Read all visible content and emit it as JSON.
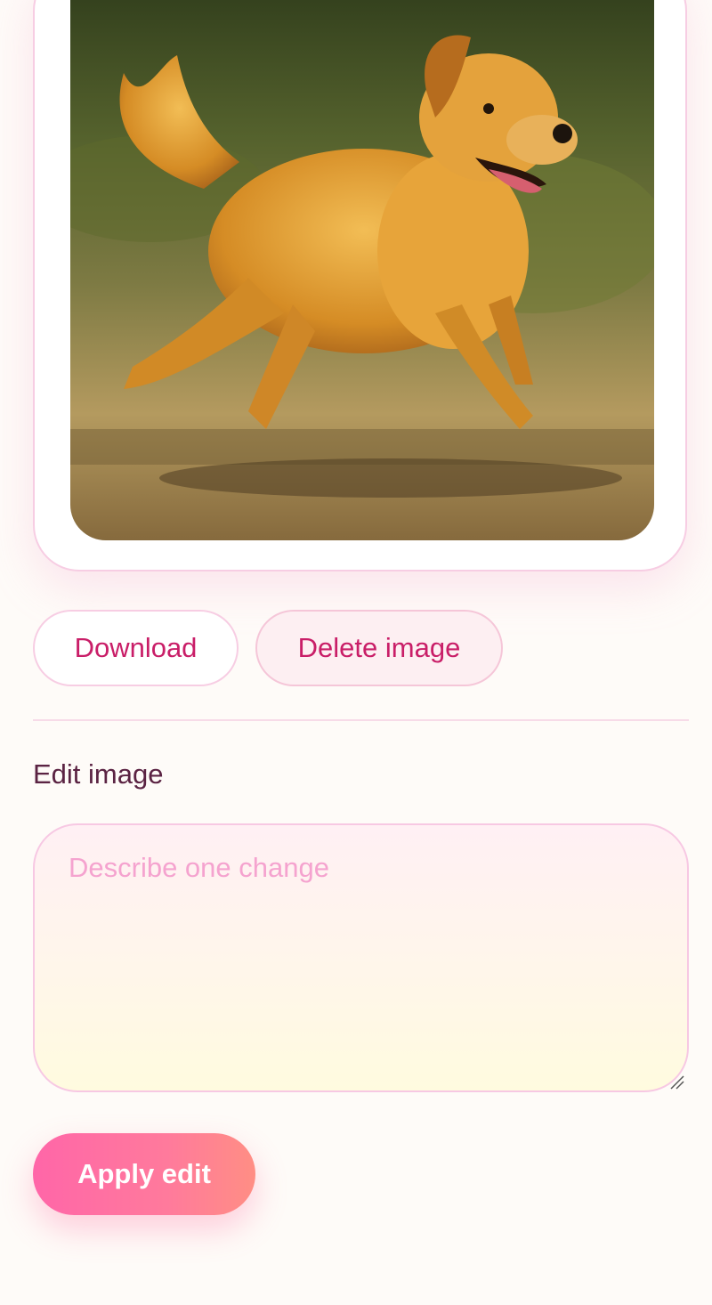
{
  "image_card": {
    "image_subject": "golden-retriever-running"
  },
  "actions": {
    "download_label": "Download",
    "delete_label": "Delete image"
  },
  "edit": {
    "section_label": "Edit image",
    "placeholder": "Describe one change",
    "value": "",
    "apply_label": "Apply edit"
  },
  "colors": {
    "accent": "#c91e68",
    "border_pink": "#f7cde3",
    "placeholder": "#f5a3cf",
    "apply_gradient_start": "#ff66a8",
    "apply_gradient_end": "#ff8e84"
  }
}
